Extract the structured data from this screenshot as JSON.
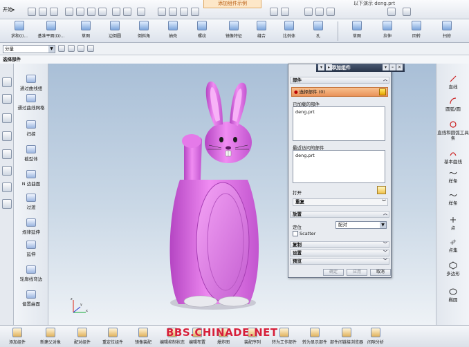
{
  "toolbar": {
    "start_label": "开始▸",
    "title_tab": "添加组件示例",
    "title_right": "以下演示 deng.prt"
  },
  "ribbon": {
    "items": [
      "求和(I)...",
      "基准平面(D)...",
      "草图",
      "边倒圆",
      "倒斜角",
      "抽壳",
      "螺纹",
      "镜像特征",
      "缝合",
      "比例体",
      "孔",
      "草图",
      "拉伸",
      "回转",
      "扫掠"
    ]
  },
  "filter": {
    "value": "分量"
  },
  "section_label": "选择部件",
  "left_tools": {
    "items": [
      "通过曲线组",
      "通过曲线网格",
      "扫掠",
      "截型体",
      "N 边曲面",
      "过渡",
      "规律延伸",
      "延伸",
      "轮廓线弯边",
      "偏置曲面"
    ]
  },
  "dialog": {
    "title": "添加组件",
    "part_group": "部件",
    "select_part": "选择部件 (0)",
    "loaded_parts_label": "已加载的部件",
    "loaded_parts": [
      "deng.prt"
    ],
    "recent_parts_label": "最近访问的部件",
    "recent_parts": [
      "deng.prt"
    ],
    "open_label": "打开",
    "reuse_label": "重复",
    "placement_group": "放置",
    "position_label": "定位",
    "position_value": "配对",
    "scatter_label": "Scatter",
    "copy_group": "复制",
    "settings_group": "设置",
    "preview_group": "预览",
    "ok": "确定",
    "apply": "应用",
    "cancel": "取消"
  },
  "right_tools": {
    "items": [
      "直线",
      "圆弧/圆",
      "直线和圆弧工具条",
      "基本曲线",
      "样条",
      "样条",
      "点",
      "点集",
      "多边形",
      "椭圆"
    ]
  },
  "bottom_tools": {
    "items": [
      "添加组件",
      "新建父对象",
      "配对组件",
      "重定位组件",
      "镜像装配",
      "编辑抑制状态",
      "编辑布置",
      "爆炸图",
      "装配序列",
      "转为工作部件",
      "转为显示部件",
      "部件间链接浏览器",
      "间隙分析"
    ]
  },
  "watermark": "BBS.CHINADE.NET",
  "colors": {
    "model": "#e27ae6",
    "dialog_title": "#2f3b52",
    "accent": "#e9925a"
  }
}
